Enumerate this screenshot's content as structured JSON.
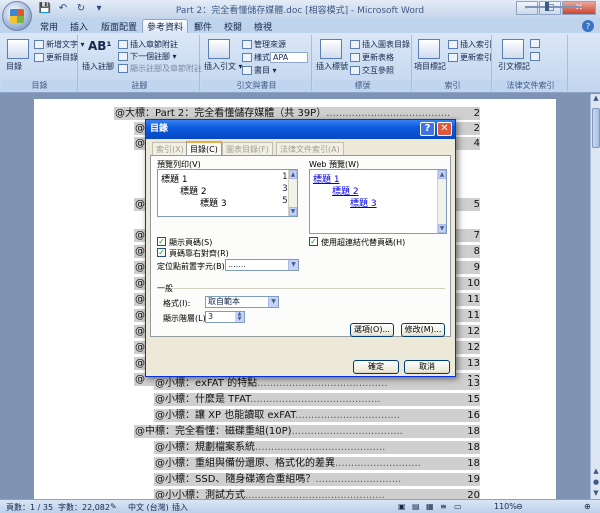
{
  "window": {
    "title": "Part 2：完全看懂儲存媒體.doc [相容模式] - Microsoft Word",
    "minimize": "–",
    "maximize": "□",
    "close": "✕"
  },
  "qat": {
    "save": "💾",
    "undo": "↶",
    "redo": "↻",
    "more": "▾"
  },
  "tabs": [
    "常用",
    "插入",
    "版面配置",
    "參考資料",
    "郵件",
    "校閱",
    "檢視"
  ],
  "active_tab": "參考資料",
  "ribbon": {
    "groups": [
      {
        "label": "目錄",
        "big": "目錄",
        "items": [
          "新增文字 ▾",
          "更新目錄"
        ]
      },
      {
        "label": "註腳",
        "big": "插入註腳",
        "big_glyph": "AB¹",
        "items": [
          "插入章節附註",
          "下一個註腳 ▾",
          "顯示註腳及章節附註"
        ]
      },
      {
        "label": "引文與書目",
        "big": "插入引文 ▾",
        "items": [
          "管理來源",
          "樣式:",
          "書目 ▾"
        ],
        "style_value": "APA"
      },
      {
        "label": "標號",
        "big": "插入標號",
        "items": [
          "插入圖表目錄",
          "更新表格",
          "交互參照"
        ]
      },
      {
        "label": "索引",
        "big": "項目標記",
        "items": [
          "插入索引",
          "更新索引"
        ]
      },
      {
        "label": "法律文件索引",
        "big": "引文標記",
        "items": []
      }
    ]
  },
  "document": {
    "lines": [
      {
        "text": "@大標：Part 2：完全看懂儲存媒體（共 39P）",
        "page": "2"
      },
      {
        "text": "@",
        "page": "2"
      },
      {
        "text": "@",
        "page": "4"
      },
      {
        "text": "@",
        "page": "5"
      },
      {
        "text": "@",
        "page": "7"
      },
      {
        "text": "@",
        "page": "8"
      },
      {
        "text": "@",
        "page": "9"
      },
      {
        "text": "@",
        "page": "10"
      },
      {
        "text": "@",
        "page": "11"
      },
      {
        "text": "@",
        "page": "11"
      },
      {
        "text": "@",
        "page": "12"
      },
      {
        "text": "@",
        "page": "12"
      },
      {
        "text": "@",
        "page": "13"
      },
      {
        "text": "@",
        "page": "13"
      },
      {
        "text": "@小標：exFAT 的特點",
        "page": "13"
      },
      {
        "text": "@小標：什麼是 TFAT",
        "page": "15"
      },
      {
        "text": "@小標：讓 XP 也能讀取 exFAT",
        "page": "16"
      },
      {
        "text": "@中標：完全看懂：磁碟重組(10P)",
        "page": "18"
      },
      {
        "text": "@小標：規劃檔案系統",
        "page": "18"
      },
      {
        "text": "@小標：重組與備份還原、格式化的差異",
        "page": "18"
      },
      {
        "text": "@小標：SSD、隨身碟適合重組嗎？",
        "page": "19"
      },
      {
        "text": "@小小標：測試方式",
        "page": "20"
      }
    ]
  },
  "dialog": {
    "title": "目錄",
    "tabs": [
      "索引(X)",
      "目錄(C)",
      "圖表目錄(F)",
      "法律文件索引(A)"
    ],
    "active_tab": "目錄(C)",
    "print_preview_label": "預覽列印(V)",
    "print_preview": [
      {
        "text": "標題 1",
        "page": "1"
      },
      {
        "text": "標題 2",
        "page": "3"
      },
      {
        "text": "標題 3",
        "page": "5"
      }
    ],
    "web_preview_label": "Web 預覽(W)",
    "web_preview": [
      "標題 1",
      "標題 2",
      "標題 3"
    ],
    "show_page_numbers": {
      "label": "顯示頁碼(S)",
      "checked": true
    },
    "right_align": {
      "label": "頁碼靠右對齊(R)",
      "checked": true
    },
    "use_hyperlinks": {
      "label": "使用超連結代替頁碼(H)",
      "checked": true
    },
    "tab_leader": {
      "label": "定位點前置字元(B):",
      "value": "......."
    },
    "general_label": "一般",
    "formats": {
      "label": "格式(I):",
      "value": "取自範本"
    },
    "show_levels": {
      "label": "顯示階層(L):",
      "value": "3"
    },
    "options_button": "選項(O)...",
    "modify_button": "修改(M)...",
    "ok_button": "確定",
    "cancel_button": "取消"
  },
  "status": {
    "page": "頁數：1 / 35",
    "words": "字數：22,082",
    "language": "中文 (台灣)",
    "mode": "插入",
    "zoom": "110%"
  }
}
